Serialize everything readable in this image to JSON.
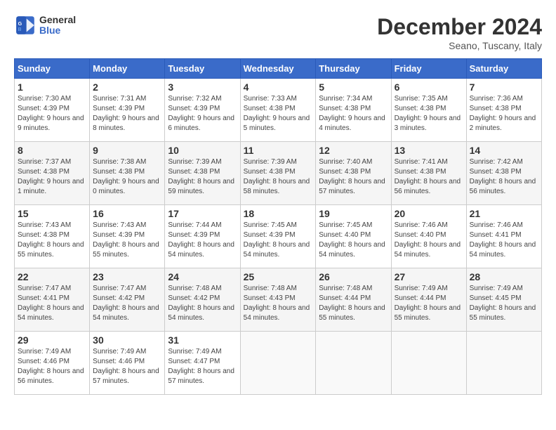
{
  "header": {
    "logo_line1": "General",
    "logo_line2": "Blue",
    "month": "December 2024",
    "location": "Seano, Tuscany, Italy"
  },
  "weekdays": [
    "Sunday",
    "Monday",
    "Tuesday",
    "Wednesday",
    "Thursday",
    "Friday",
    "Saturday"
  ],
  "weeks": [
    [
      {
        "day": "1",
        "sunrise": "7:30 AM",
        "sunset": "4:39 PM",
        "daylight": "9 hours and 9 minutes."
      },
      {
        "day": "2",
        "sunrise": "7:31 AM",
        "sunset": "4:39 PM",
        "daylight": "9 hours and 8 minutes."
      },
      {
        "day": "3",
        "sunrise": "7:32 AM",
        "sunset": "4:39 PM",
        "daylight": "9 hours and 6 minutes."
      },
      {
        "day": "4",
        "sunrise": "7:33 AM",
        "sunset": "4:38 PM",
        "daylight": "9 hours and 5 minutes."
      },
      {
        "day": "5",
        "sunrise": "7:34 AM",
        "sunset": "4:38 PM",
        "daylight": "9 hours and 4 minutes."
      },
      {
        "day": "6",
        "sunrise": "7:35 AM",
        "sunset": "4:38 PM",
        "daylight": "9 hours and 3 minutes."
      },
      {
        "day": "7",
        "sunrise": "7:36 AM",
        "sunset": "4:38 PM",
        "daylight": "9 hours and 2 minutes."
      }
    ],
    [
      {
        "day": "8",
        "sunrise": "7:37 AM",
        "sunset": "4:38 PM",
        "daylight": "9 hours and 1 minute."
      },
      {
        "day": "9",
        "sunrise": "7:38 AM",
        "sunset": "4:38 PM",
        "daylight": "9 hours and 0 minutes."
      },
      {
        "day": "10",
        "sunrise": "7:39 AM",
        "sunset": "4:38 PM",
        "daylight": "8 hours and 59 minutes."
      },
      {
        "day": "11",
        "sunrise": "7:39 AM",
        "sunset": "4:38 PM",
        "daylight": "8 hours and 58 minutes."
      },
      {
        "day": "12",
        "sunrise": "7:40 AM",
        "sunset": "4:38 PM",
        "daylight": "8 hours and 57 minutes."
      },
      {
        "day": "13",
        "sunrise": "7:41 AM",
        "sunset": "4:38 PM",
        "daylight": "8 hours and 56 minutes."
      },
      {
        "day": "14",
        "sunrise": "7:42 AM",
        "sunset": "4:38 PM",
        "daylight": "8 hours and 56 minutes."
      }
    ],
    [
      {
        "day": "15",
        "sunrise": "7:43 AM",
        "sunset": "4:38 PM",
        "daylight": "8 hours and 55 minutes."
      },
      {
        "day": "16",
        "sunrise": "7:43 AM",
        "sunset": "4:39 PM",
        "daylight": "8 hours and 55 minutes."
      },
      {
        "day": "17",
        "sunrise": "7:44 AM",
        "sunset": "4:39 PM",
        "daylight": "8 hours and 54 minutes."
      },
      {
        "day": "18",
        "sunrise": "7:45 AM",
        "sunset": "4:39 PM",
        "daylight": "8 hours and 54 minutes."
      },
      {
        "day": "19",
        "sunrise": "7:45 AM",
        "sunset": "4:40 PM",
        "daylight": "8 hours and 54 minutes."
      },
      {
        "day": "20",
        "sunrise": "7:46 AM",
        "sunset": "4:40 PM",
        "daylight": "8 hours and 54 minutes."
      },
      {
        "day": "21",
        "sunrise": "7:46 AM",
        "sunset": "4:41 PM",
        "daylight": "8 hours and 54 minutes."
      }
    ],
    [
      {
        "day": "22",
        "sunrise": "7:47 AM",
        "sunset": "4:41 PM",
        "daylight": "8 hours and 54 minutes."
      },
      {
        "day": "23",
        "sunrise": "7:47 AM",
        "sunset": "4:42 PM",
        "daylight": "8 hours and 54 minutes."
      },
      {
        "day": "24",
        "sunrise": "7:48 AM",
        "sunset": "4:42 PM",
        "daylight": "8 hours and 54 minutes."
      },
      {
        "day": "25",
        "sunrise": "7:48 AM",
        "sunset": "4:43 PM",
        "daylight": "8 hours and 54 minutes."
      },
      {
        "day": "26",
        "sunrise": "7:48 AM",
        "sunset": "4:44 PM",
        "daylight": "8 hours and 55 minutes."
      },
      {
        "day": "27",
        "sunrise": "7:49 AM",
        "sunset": "4:44 PM",
        "daylight": "8 hours and 55 minutes."
      },
      {
        "day": "28",
        "sunrise": "7:49 AM",
        "sunset": "4:45 PM",
        "daylight": "8 hours and 55 minutes."
      }
    ],
    [
      {
        "day": "29",
        "sunrise": "7:49 AM",
        "sunset": "4:46 PM",
        "daylight": "8 hours and 56 minutes."
      },
      {
        "day": "30",
        "sunrise": "7:49 AM",
        "sunset": "4:46 PM",
        "daylight": "8 hours and 57 minutes."
      },
      {
        "day": "31",
        "sunrise": "7:49 AM",
        "sunset": "4:47 PM",
        "daylight": "8 hours and 57 minutes."
      },
      null,
      null,
      null,
      null
    ]
  ]
}
